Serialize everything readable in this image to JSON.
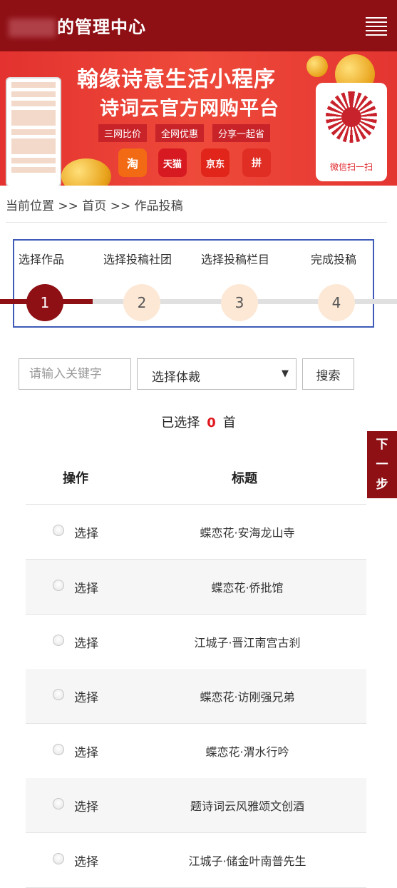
{
  "header": {
    "title": "的管理中心"
  },
  "banner": {
    "headline": "翰缘诗意生活小程序",
    "subheadline": "诗词云官方网购平台",
    "tags": [
      "三网比价",
      "全网优惠",
      "分享一起省"
    ],
    "shops": [
      "淘",
      "天猫",
      "京东",
      "拼"
    ],
    "qr_center": "翰缘",
    "qr_label": "微信扫一扫"
  },
  "breadcrumb": "当前位置 >> 首页 >> 作品投稿",
  "steps": [
    {
      "label": "选择作品",
      "num": "1"
    },
    {
      "label": "选择投稿社团",
      "num": "2"
    },
    {
      "label": "选择投稿栏目",
      "num": "3"
    },
    {
      "label": "完成投稿",
      "num": "4"
    }
  ],
  "search": {
    "placeholder": "请输入关键字",
    "genre_selected": "选择体裁",
    "button": "搜索"
  },
  "selected": {
    "prefix": "已选择",
    "count": "0",
    "suffix": "首"
  },
  "next_button": {
    "c1": "下",
    "c2": "一",
    "c3": "步"
  },
  "table": {
    "col_action": "操作",
    "col_title": "标题",
    "rows": [
      {
        "action": "选择",
        "title": "蝶恋花·安海龙山寺"
      },
      {
        "action": "选择",
        "title": "蝶恋花·侨批馆"
      },
      {
        "action": "选择",
        "title": "江城子·晋江南宫古刹"
      },
      {
        "action": "选择",
        "title": "蝶恋花·访刚强兄弟"
      },
      {
        "action": "选择",
        "title": "蝶恋花·渭水行吟"
      },
      {
        "action": "选择",
        "title": "题诗词云风雅颂文创酒"
      },
      {
        "action": "选择",
        "title": "江城子·储金叶南普先生"
      }
    ]
  },
  "colors": {
    "brand": "#8e1015",
    "accent_red": "#e0181e",
    "step_idle": "#fde8d6",
    "highlight_box": "#3d5bb7"
  }
}
